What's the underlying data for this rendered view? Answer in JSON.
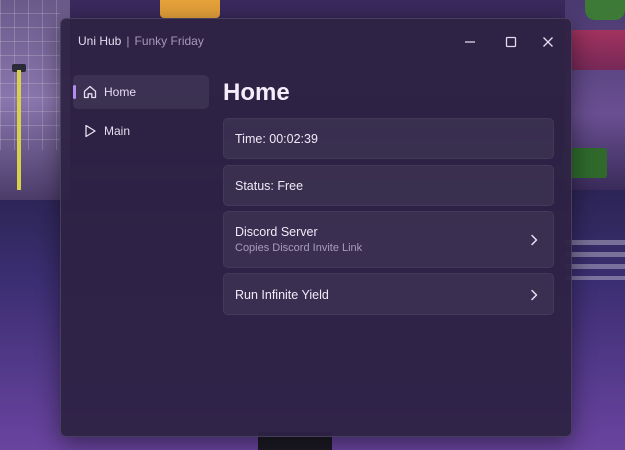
{
  "window": {
    "title": "Uni Hub",
    "separator": "|",
    "subtitle": "Funky Friday"
  },
  "icons": {
    "minimize": "minimize-icon",
    "maximize": "maximize-icon",
    "close": "close-icon",
    "home": "home-icon",
    "main": "play-icon",
    "chevron": "chevron-right-icon"
  },
  "sidebar": {
    "items": [
      {
        "label": "Home",
        "icon": "home-icon",
        "active": true
      },
      {
        "label": "Main",
        "icon": "play-icon",
        "active": false
      }
    ]
  },
  "main": {
    "title": "Home",
    "cards": [
      {
        "title": "Time: 00:02:39"
      },
      {
        "title": "Status: Free"
      },
      {
        "title": "Discord Server",
        "description": "Copies Discord Invite Link"
      },
      {
        "title": "Run Infinite Yield"
      }
    ]
  },
  "colors": {
    "accent": "#b48cf0",
    "window_bg": "#2e2244",
    "text_primary": "#f0eaf7",
    "text_secondary": "#a99bbd"
  }
}
